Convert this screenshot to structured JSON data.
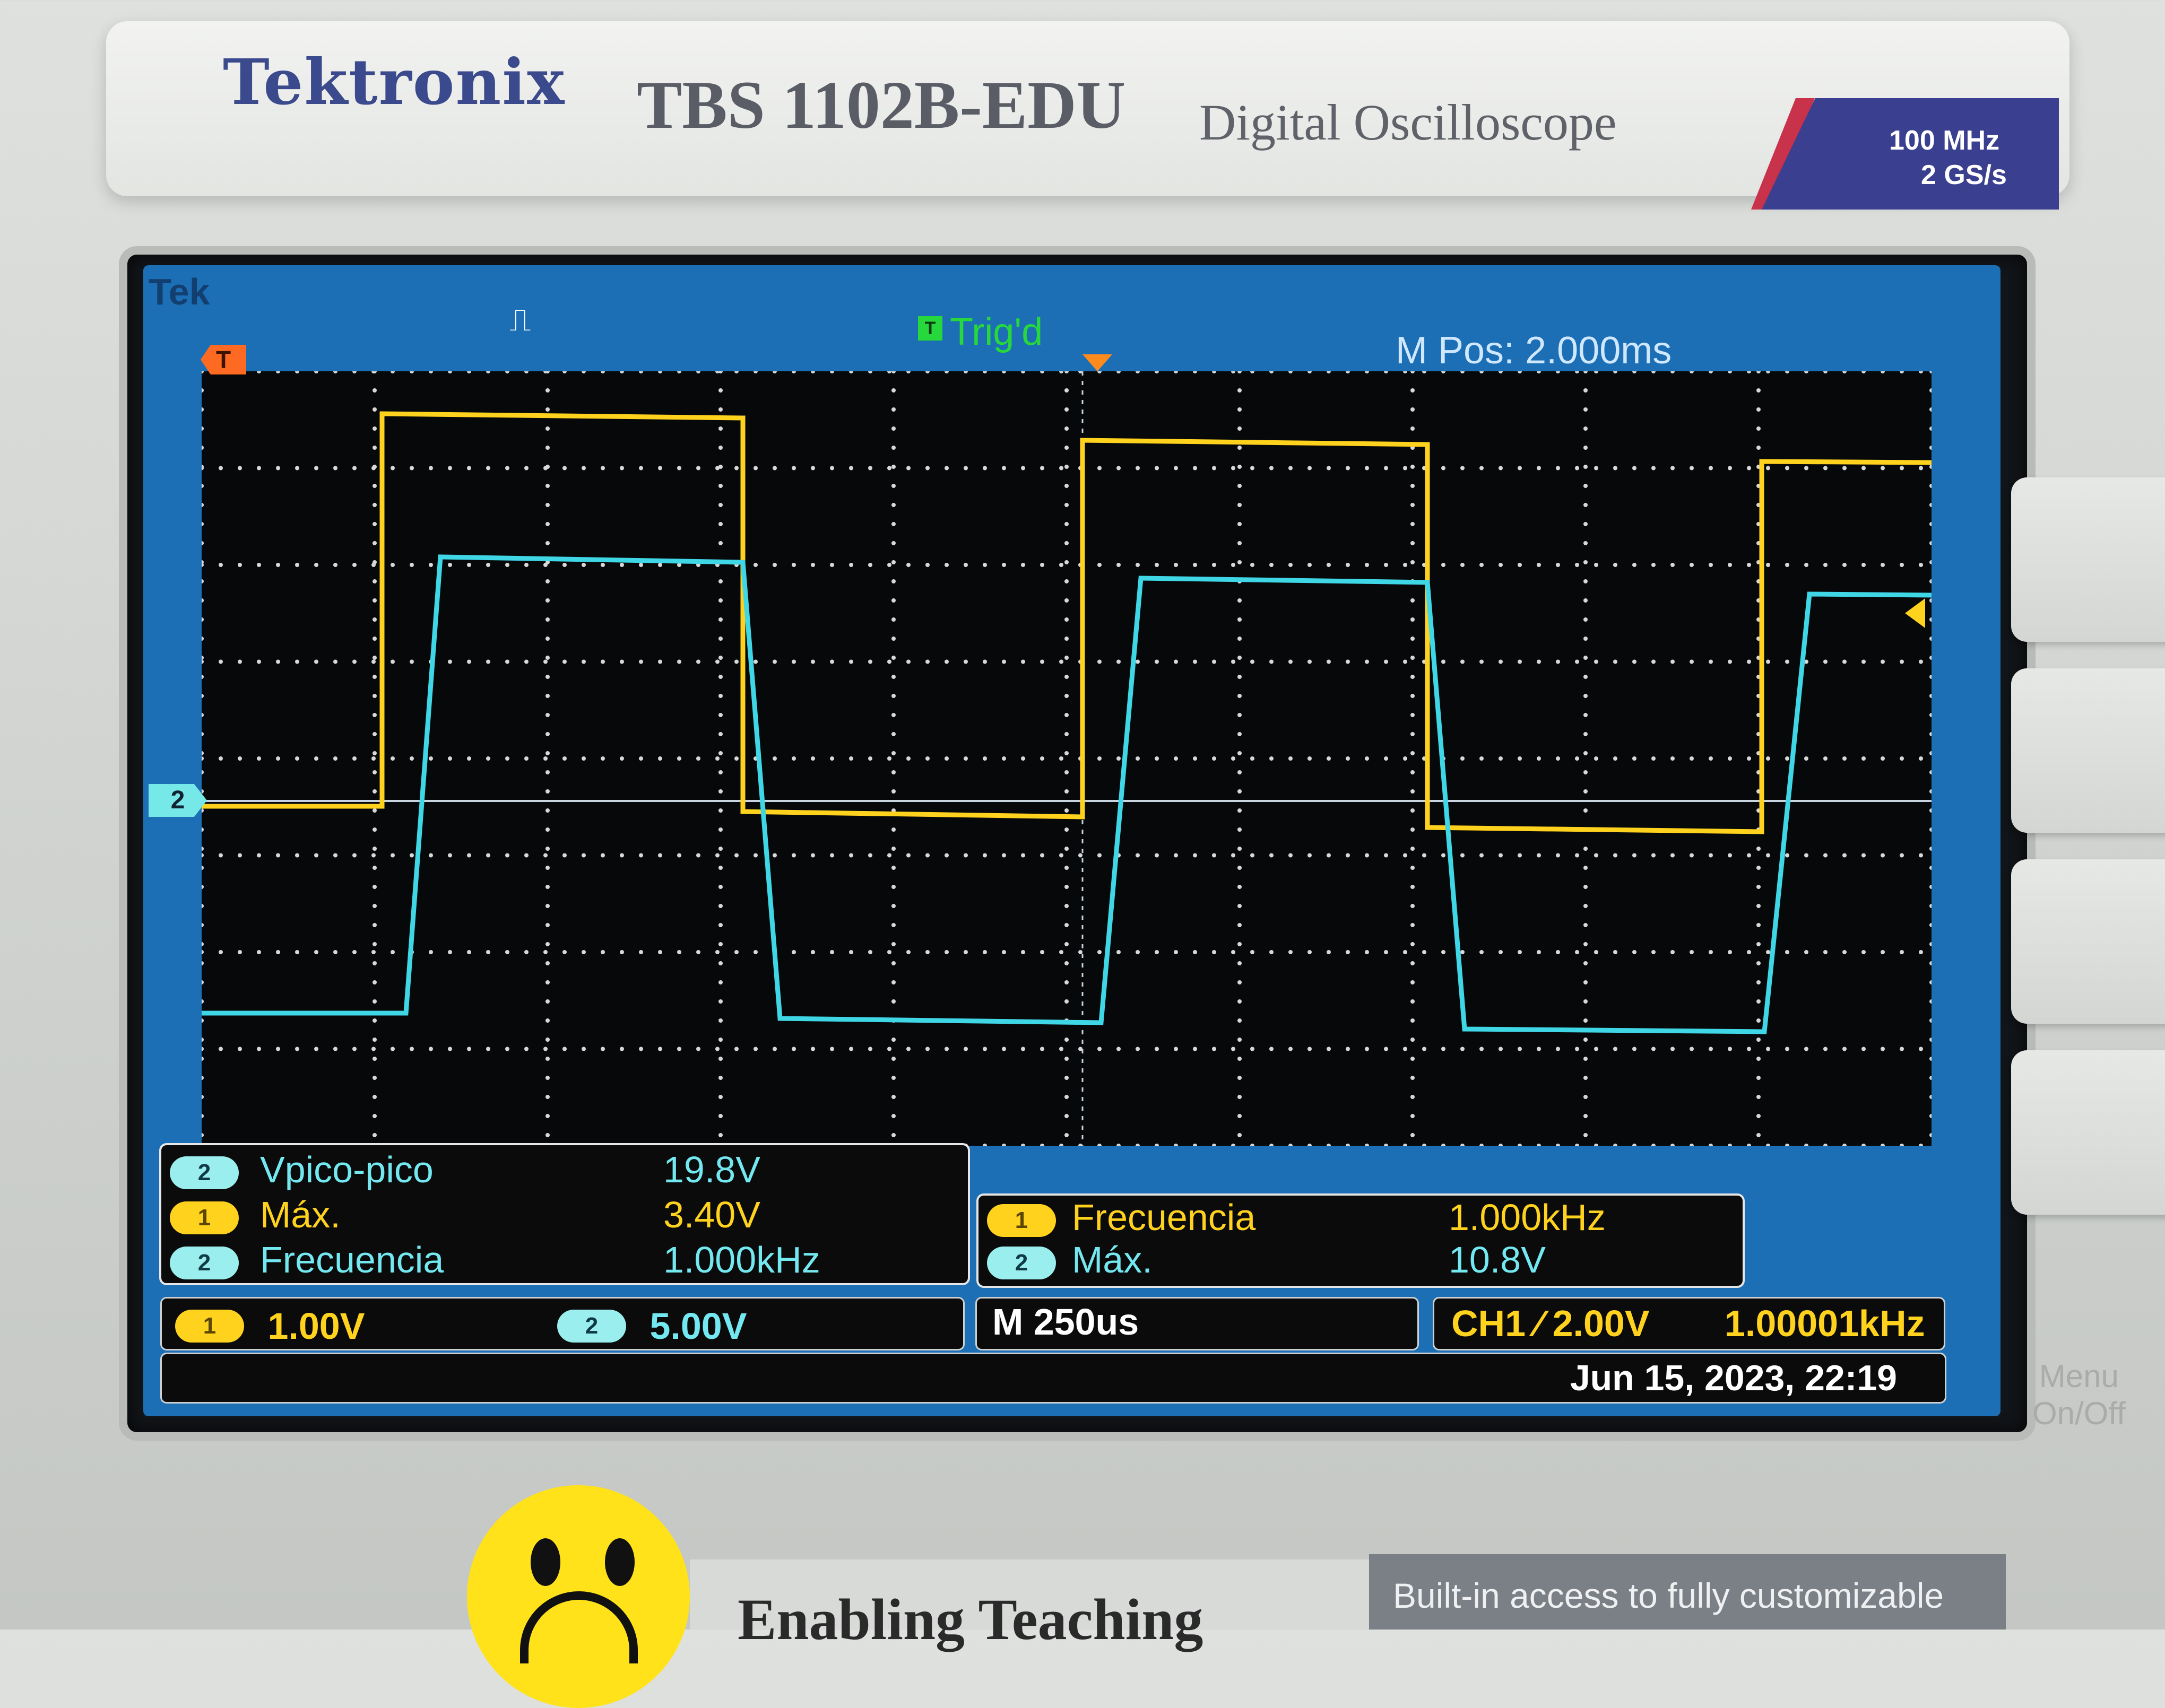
{
  "device": {
    "brand": "Tektronix",
    "model": "TBS 1102B-EDU",
    "description": "Digital Oscilloscope",
    "badge": {
      "bandwidth": "100 MHz",
      "sample_rate": "2 GS/s"
    }
  },
  "screen": {
    "tek_label": "Tek",
    "trigger_status": "Trig'd",
    "trigger_status_icon": "T",
    "m_pos": "M Pos: 2.000ms",
    "trigger_marker_label": "T",
    "ch2_ground_marker_label": "2"
  },
  "measurements_left": [
    {
      "channel": "2",
      "label": "Vpico-pico",
      "value": "19.8V"
    },
    {
      "channel": "1",
      "label": "Máx.",
      "value": "3.40V"
    },
    {
      "channel": "2",
      "label": "Frecuencia",
      "value": "1.000kHz"
    }
  ],
  "measurements_right": [
    {
      "channel": "1",
      "label": "Frecuencia",
      "value": "1.000kHz"
    },
    {
      "channel": "2",
      "label": "Máx.",
      "value": "10.8V"
    }
  ],
  "status": {
    "ch1_scale": "1.00V",
    "ch2_scale": "5.00V",
    "timebase": "M 250us",
    "trigger_setting": "CH1 ⁄ 2.00V",
    "trigger_frequency": "1.00001kHz",
    "datetime": "Jun 15, 2023, 22:19"
  },
  "bezel": {
    "menu_label_1": "Menu",
    "menu_label_2": "On/Off"
  },
  "front_panel": {
    "bottom_text": "Enabling Teaching",
    "builtin_text": "Built-in access to fully customizable"
  },
  "colors": {
    "ch1": "#ffd21e",
    "ch2": "#73e8f0",
    "screen_frame": "#1c6fb4"
  }
}
